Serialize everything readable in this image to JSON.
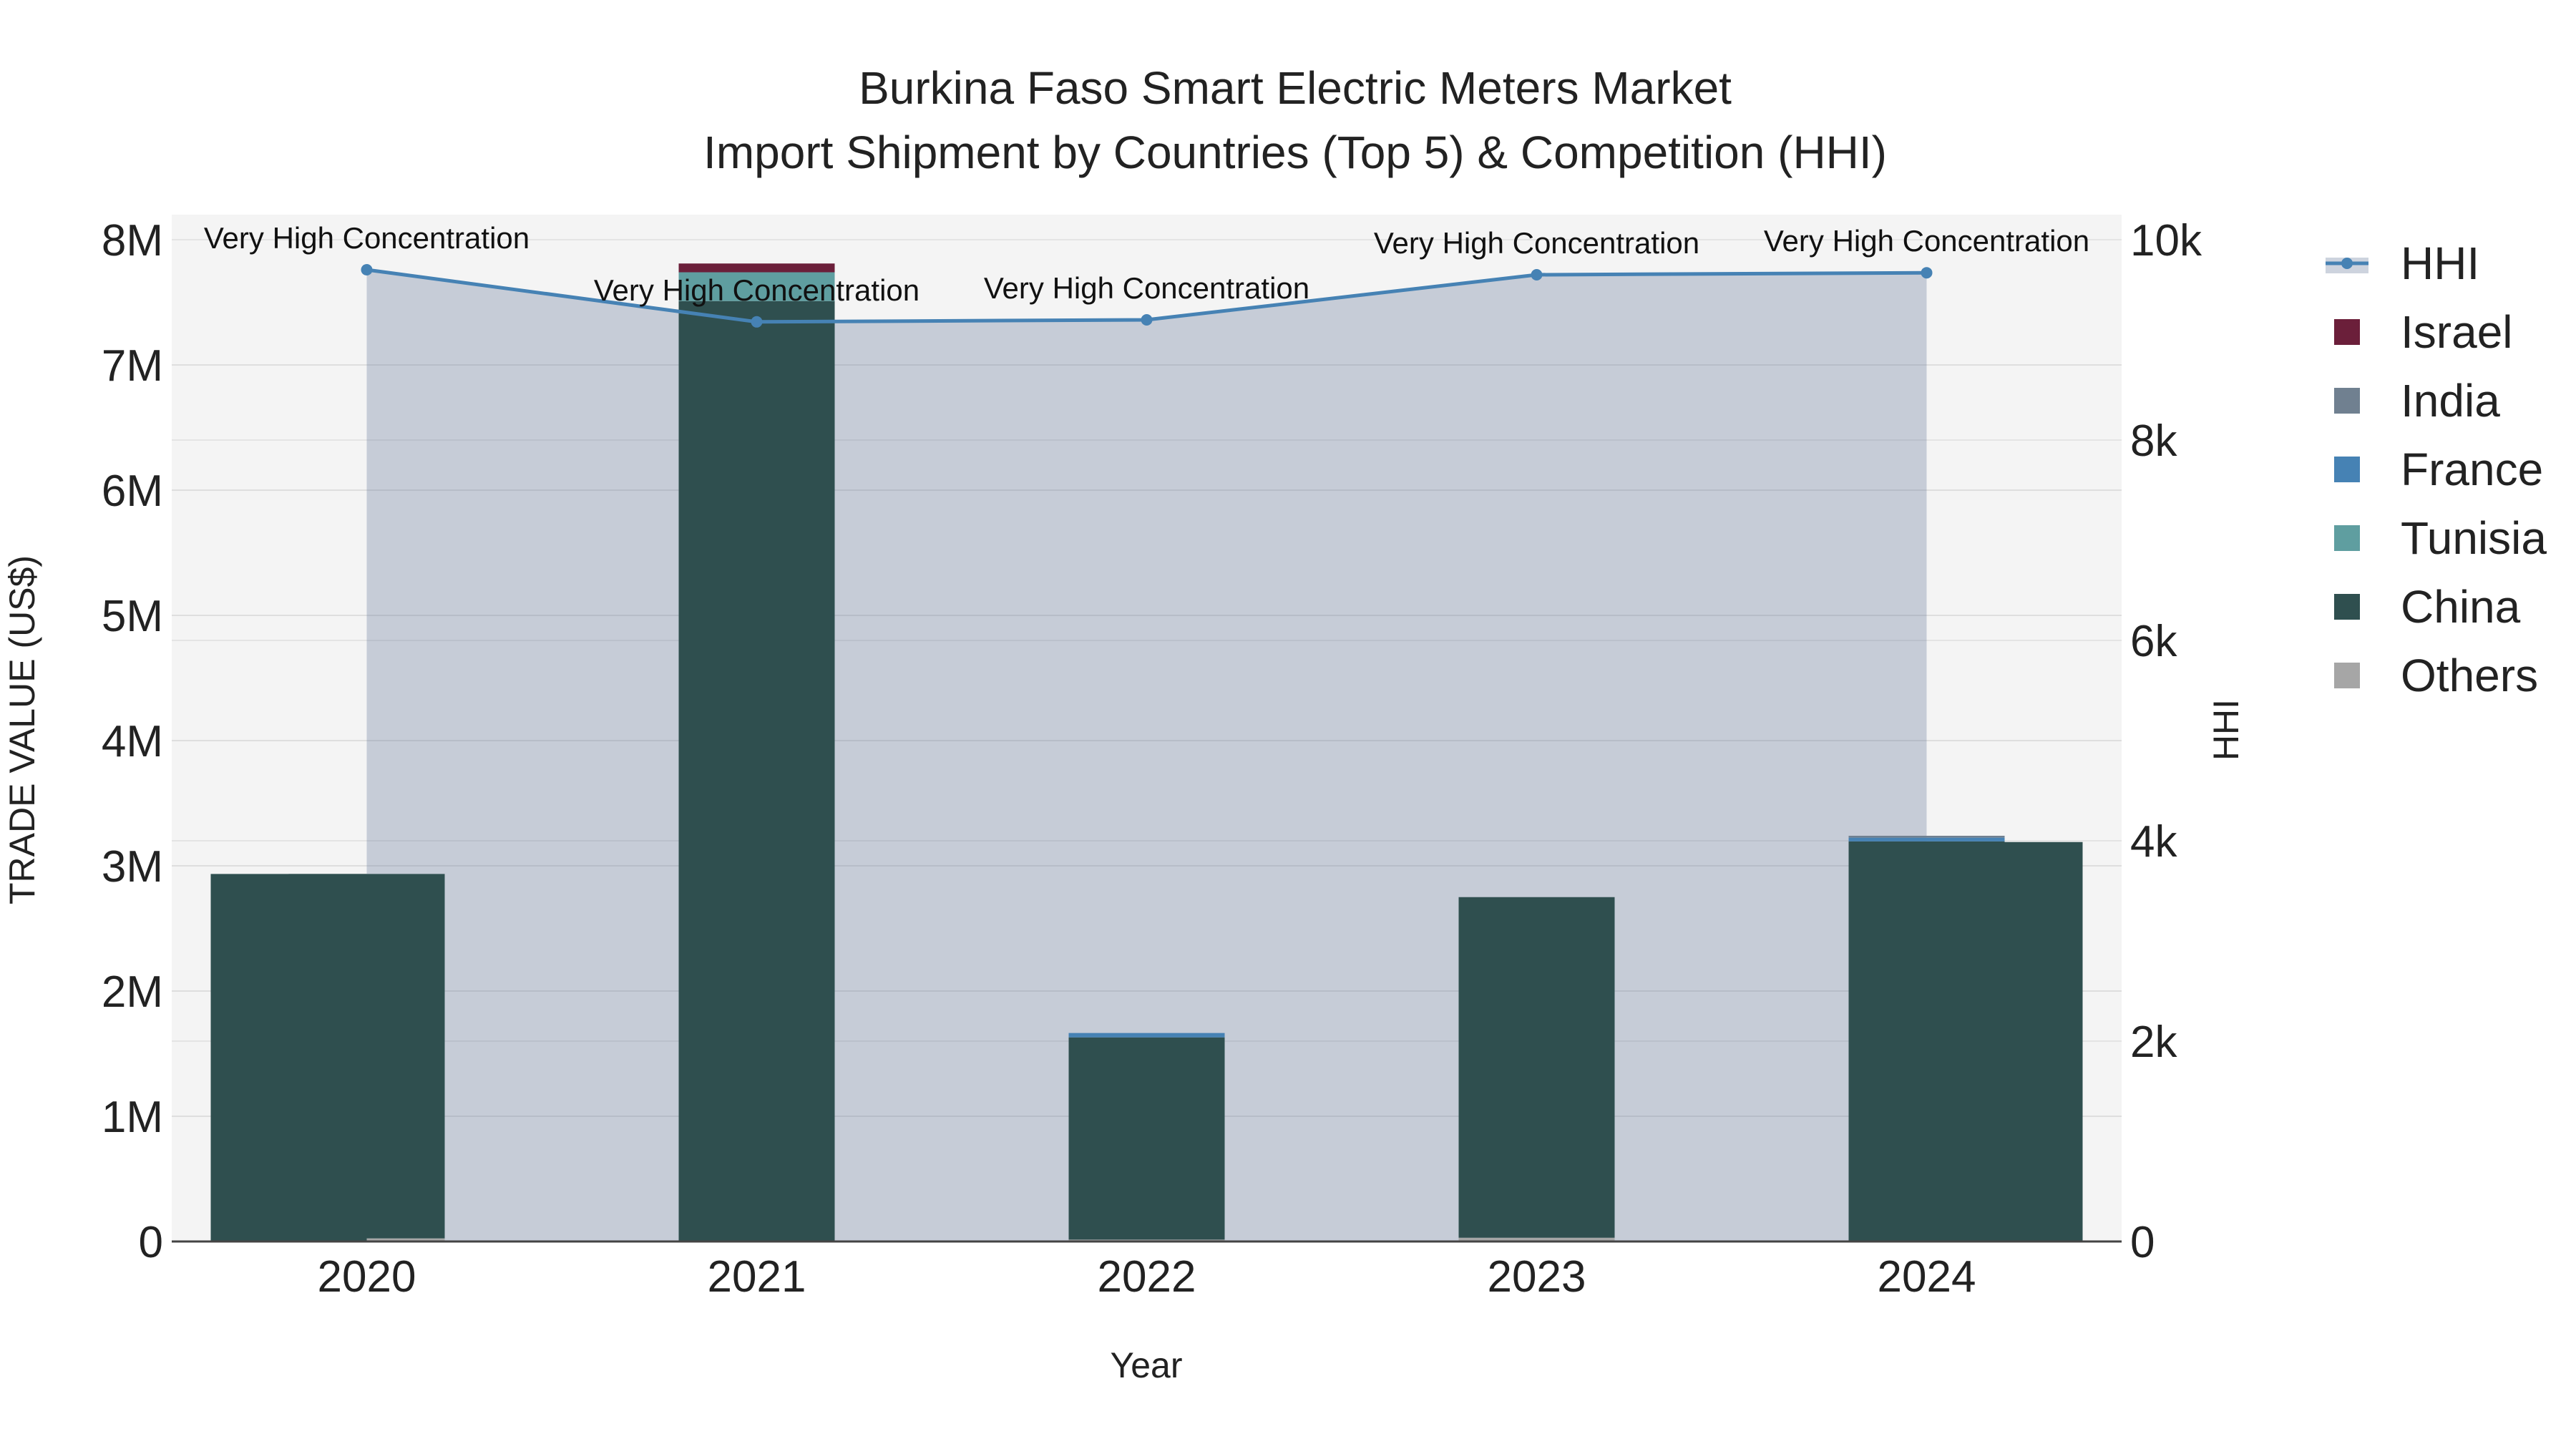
{
  "chart_data": {
    "type": "bar",
    "title": "Burkina Faso Smart Electric Meters Market",
    "subtitle": "Import Shipment by Countries (Top 5) & Competition (HHI)",
    "xlabel": "Year",
    "ylabel": "TRADE VALUE (US$)",
    "y2label": "HHI",
    "categories": [
      "2020",
      "2021",
      "2022",
      "2023",
      "2024"
    ],
    "ylim": [
      0,
      8200000
    ],
    "y2lim": [
      0,
      10250
    ],
    "y_ticks": [
      {
        "value": 0,
        "label": "0"
      },
      {
        "value": 1000000,
        "label": "1M"
      },
      {
        "value": 2000000,
        "label": "2M"
      },
      {
        "value": 3000000,
        "label": "3M"
      },
      {
        "value": 4000000,
        "label": "4M"
      },
      {
        "value": 5000000,
        "label": "5M"
      },
      {
        "value": 6000000,
        "label": "6M"
      },
      {
        "value": 7000000,
        "label": "7M"
      },
      {
        "value": 8000000,
        "label": "8M"
      }
    ],
    "y2_ticks": [
      {
        "value": 0,
        "label": "0"
      },
      {
        "value": 2000,
        "label": "2k"
      },
      {
        "value": 4000,
        "label": "4k"
      },
      {
        "value": 6000,
        "label": "6k"
      },
      {
        "value": 8000,
        "label": "8k"
      },
      {
        "value": 10000,
        "label": "10k"
      }
    ],
    "grid": true,
    "legend_position": "right",
    "series": [
      {
        "name": "Others",
        "color": "#a6a6a6",
        "values": [
          25000,
          5000,
          15000,
          30000,
          5000
        ]
      },
      {
        "name": "China",
        "color": "#2f4f4f",
        "values": [
          2910000,
          7505000,
          1615000,
          2720000,
          3190000
        ]
      },
      {
        "name": "Tunisia",
        "color": "#5f9ea0",
        "values": [
          0,
          230000,
          0,
          0,
          0
        ]
      },
      {
        "name": "France",
        "color": "#4682b4",
        "values": [
          0,
          0,
          35000,
          0,
          30000
        ]
      },
      {
        "name": "India",
        "color": "#708090",
        "values": [
          0,
          0,
          0,
          0,
          15000
        ]
      },
      {
        "name": "Israel",
        "color": "#6b1f3a",
        "values": [
          0,
          70000,
          0,
          0,
          0
        ]
      }
    ],
    "hhi": {
      "name": "HHI",
      "color": "#4682b4",
      "values": [
        9700,
        9180,
        9200,
        9650,
        9670
      ],
      "labels": [
        "Very High Concentration",
        "Very High Concentration",
        "Very High Concentration",
        "Very High Concentration",
        "Very High Concentration"
      ]
    },
    "legend": [
      "HHI",
      "Israel",
      "India",
      "France",
      "Tunisia",
      "China",
      "Others"
    ]
  }
}
